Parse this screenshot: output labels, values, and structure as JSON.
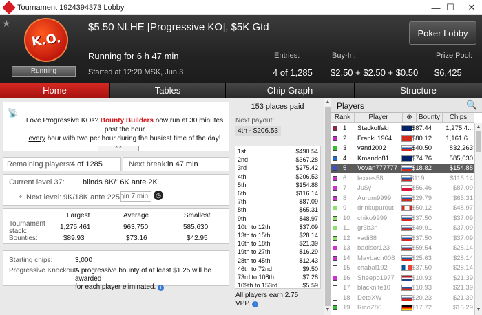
{
  "window": {
    "title": "Tournament 1924394373 Lobby",
    "minimize": "—",
    "maximize": "☐",
    "close": "✕"
  },
  "header": {
    "title": "$5.50 NLHE [Progressive KO], $5K Gtd",
    "badge_text": "K.O.",
    "running_badge": "Running",
    "running_for": "Running for 6 h 47 min",
    "started_at": "Started at 12:20 MSK, Jun 3",
    "lobby_button": "Poker Lobby",
    "entries_label": "Entries:",
    "entries_value": "4 of 1,285",
    "buyin_label": "Buy-In:",
    "buyin_value": "$2.50 + $2.50 + $0.50",
    "prizepool_label": "Prize Pool:",
    "prizepool_value": "$6,425"
  },
  "tabs": [
    {
      "label": "Home",
      "active": true
    },
    {
      "label": "Tables"
    },
    {
      "label": "Chip Graph"
    },
    {
      "label": "Structure"
    }
  ],
  "promo": {
    "line1_pre": "Love Progressive KOs?",
    "line1_highlight": "Bounty Builders",
    "line1_post": "now run at 30 minutes past the hour",
    "line2_em": "every",
    "line2_rest": "hour with two per hour during the busiest time of the day!"
  },
  "status": {
    "remaining_label": "Remaining players:",
    "remaining_value": "4 of 1285",
    "next_break_label": "Next break:",
    "next_break_value": "in 47 min"
  },
  "level": {
    "current_label": "Current level 37:",
    "current_value": "blinds 8K/16K ante 2K",
    "next_label": "Next level:",
    "next_value": "9K/18K ante 2250",
    "next_timer": "in 7 min"
  },
  "stack_table": {
    "headers": [
      "Largest",
      "Average",
      "Smallest"
    ],
    "stack_label": "Tournament stack:",
    "stack_values": [
      "1,275,461",
      "963,750",
      "585,630"
    ],
    "bounty_label": "Bounties:",
    "bounty_values": [
      "$89.93",
      "$73.16",
      "$42.95"
    ]
  },
  "info": {
    "starting_label": "Starting chips:",
    "starting_value": "3,000",
    "pko_label": "Progressive Knockout:",
    "pko_text_1": "A progressive bounty of at least $1.25 will be awarded",
    "pko_text_2": "for each player eliminated."
  },
  "payouts": {
    "places_paid": "153 places paid",
    "next_label": "Next payout:",
    "next_value": "4th - $206.53",
    "rows": [
      {
        "place": "1st",
        "amount": "$490.54"
      },
      {
        "place": "2nd",
        "amount": "$367.28"
      },
      {
        "place": "3rd",
        "amount": "$275.42"
      },
      {
        "place": "4th",
        "amount": "$206.53"
      },
      {
        "place": "5th",
        "amount": "$154.88"
      },
      {
        "place": "6th",
        "amount": "$116.14"
      },
      {
        "place": "7th",
        "amount": "$87.09"
      },
      {
        "place": "8th",
        "amount": "$65.31"
      },
      {
        "place": "9th",
        "amount": "$48.97"
      },
      {
        "place": "10th to 12th",
        "amount": "$37.09"
      },
      {
        "place": "13th to 15th",
        "amount": "$28.14"
      },
      {
        "place": "16th to 18th",
        "amount": "$21.39"
      },
      {
        "place": "19th to 27th",
        "amount": "$16.29"
      },
      {
        "place": "28th to 45th",
        "amount": "$12.43"
      },
      {
        "place": "46th to 72nd",
        "amount": "$9.50"
      },
      {
        "place": "73rd to 108th",
        "amount": "$7.28"
      },
      {
        "place": "109th to 153rd",
        "amount": "$5.59"
      }
    ],
    "vpp_line1": "All players earn 2.75",
    "vpp_line2": "VPP."
  },
  "players": {
    "title": "Players",
    "columns": [
      "Rank",
      "Player",
      "",
      "Bounty",
      "Chips"
    ],
    "rows": [
      {
        "rank": "1",
        "name": "Stackoffski",
        "flag": "au",
        "bounty": "$87.44",
        "chips": "1,275,4...",
        "color": "#9b1b4b"
      },
      {
        "rank": "2",
        "name": "Franki 1964",
        "flag": "ch",
        "bounty": "$80.12",
        "chips": "1,161,6...",
        "color": "#d01cd0"
      },
      {
        "rank": "3",
        "name": "vand2002",
        "flag": "ru",
        "bounty": "$40.50",
        "chips": "832,263",
        "color": "#2fbf2f"
      },
      {
        "rank": "4",
        "name": "Kmando81",
        "flag": "au",
        "bounty": "$74.76",
        "chips": "585,630",
        "color": "#1f66d6"
      },
      {
        "rank": "5",
        "name": "Vovan777777",
        "flag": "ru",
        "bounty": "$18.82",
        "chips": "$154.88",
        "color": "#3b4fd6",
        "selected": true
      },
      {
        "rank": "6",
        "name": "lexxes58",
        "flag": "ru",
        "bounty": "$119....",
        "chips": "$116.14",
        "color": "#d02fd0",
        "dim": true
      },
      {
        "rank": "7",
        "name": "Ju$y",
        "flag": "pl",
        "bounty": "$56.46",
        "chips": "$87.09",
        "color": "#d02fd0",
        "dim": true
      },
      {
        "rank": "8",
        "name": "Aurum9999",
        "flag": "ru",
        "bounty": "$29.79",
        "chips": "$65.31",
        "color": "#d02fd0",
        "dim": true
      },
      {
        "rank": "9",
        "name": "drinkupurout",
        "flag": "ca",
        "bounty": "$50.12",
        "chips": "$48.97",
        "color": "#8ce06b",
        "dim": true
      },
      {
        "rank": "10",
        "name": "chiko9999",
        "flag": "ru",
        "bounty": "$37.50",
        "chips": "$37.09",
        "color": "#8ce06b",
        "dim": true
      },
      {
        "rank": "11",
        "name": "gr3b3n",
        "flag": "ru",
        "bounty": "$49.91",
        "chips": "$37.09",
        "color": "#8ce06b",
        "dim": true
      },
      {
        "rank": "12",
        "name": "vadi88",
        "flag": "ru",
        "bounty": "$37.50",
        "chips": "$37.09",
        "color": "#8ce06b",
        "dim": true
      },
      {
        "rank": "13",
        "name": "badisor123",
        "flag": "ru",
        "bounty": "$59.54",
        "chips": "$28.14",
        "color": "#d02fd0",
        "dim": true
      },
      {
        "rank": "14",
        "name": "Maybach008",
        "flag": "ru",
        "bounty": "$25.63",
        "chips": "$28.14",
        "color": "#d02fd0",
        "dim": true
      },
      {
        "rank": "15",
        "name": "chabal192",
        "flag": "fr",
        "bounty": "$37.50",
        "chips": "$28.14",
        "color": "#ffffff",
        "dim": true
      },
      {
        "rank": "16",
        "name": "Sheepo1977",
        "flag": "nl",
        "bounty": "$10.93",
        "chips": "$21.39",
        "color": "#d02fd0",
        "dim": true
      },
      {
        "rank": "17",
        "name": "blacknite10",
        "flag": "ru",
        "bounty": "$10.93",
        "chips": "$21.39",
        "color": "#ffffff",
        "dim": true
      },
      {
        "rank": "18",
        "name": "DetoXW",
        "flag": "ru",
        "bounty": "$20.23",
        "chips": "$21.39",
        "color": "#ffffff",
        "dim": true
      },
      {
        "rank": "19",
        "name": "RicoZ80",
        "flag": "de",
        "bounty": "$17.72",
        "chips": "$16.29",
        "color": "#2fbf2f",
        "dim": true
      }
    ]
  }
}
